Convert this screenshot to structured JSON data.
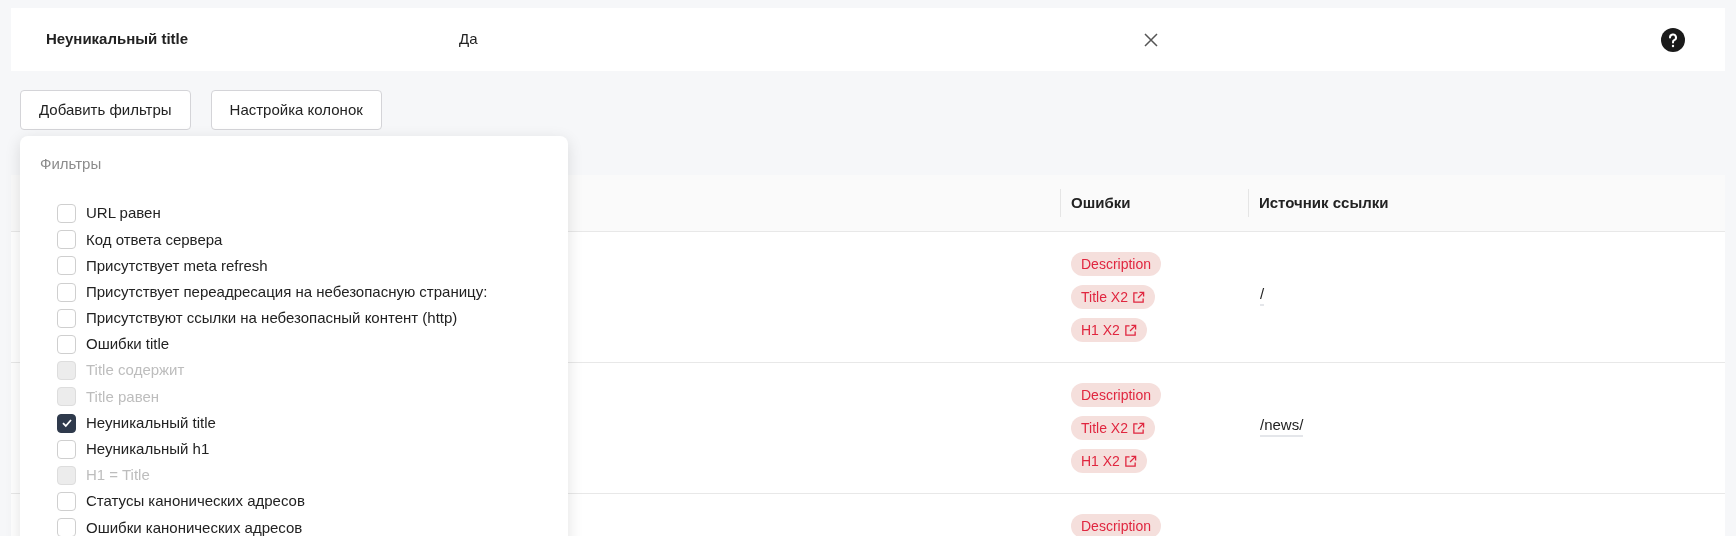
{
  "active_filter": {
    "label": "Неуникальный title",
    "value": "Да"
  },
  "toolbar": {
    "buttons": [
      "Добавить фильтры",
      "Настройка колонок"
    ]
  },
  "filters_menu": {
    "title": "Фильтры",
    "items": [
      {
        "label": "URL равен",
        "checked": false,
        "disabled": false
      },
      {
        "label": "Код ответа сервера",
        "checked": false,
        "disabled": false
      },
      {
        "label": "Присутствует meta refresh",
        "checked": false,
        "disabled": false
      },
      {
        "label": "Присутствует переадресация на небезопасную страницу:",
        "checked": false,
        "disabled": false
      },
      {
        "label": "Присутствуют ссылки на небезопасный контент (http)",
        "checked": false,
        "disabled": false
      },
      {
        "label": "Ошибки title",
        "checked": false,
        "disabled": false
      },
      {
        "label": "Title содержит",
        "checked": false,
        "disabled": true
      },
      {
        "label": "Title равен",
        "checked": false,
        "disabled": true
      },
      {
        "label": "Неуникальный title",
        "checked": true,
        "disabled": false
      },
      {
        "label": "Неуникальный h1",
        "checked": false,
        "disabled": false
      },
      {
        "label": "H1 = Title",
        "checked": false,
        "disabled": true
      },
      {
        "label": "Статусы канонических адресов",
        "checked": false,
        "disabled": false
      },
      {
        "label": "Ошибки канонических адресов",
        "checked": false,
        "disabled": false
      }
    ]
  },
  "table": {
    "columns": [
      "Ошибки",
      "Источник ссылки"
    ],
    "rows": [
      {
        "errors": [
          {
            "label": "Description",
            "link": false
          },
          {
            "label": "Title X2",
            "link": true
          },
          {
            "label": "H1 X2",
            "link": true
          }
        ],
        "source": "/"
      },
      {
        "errors": [
          {
            "label": "Description",
            "link": false
          },
          {
            "label": "Title X2",
            "link": true
          },
          {
            "label": "H1 X2",
            "link": true
          }
        ],
        "source": "/news/"
      },
      {
        "errors": [
          {
            "label": "Description",
            "link": false
          }
        ]
      }
    ]
  }
}
